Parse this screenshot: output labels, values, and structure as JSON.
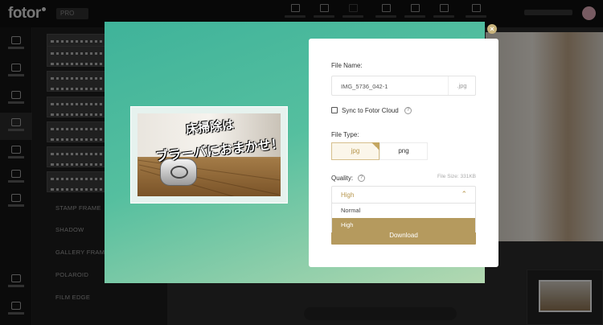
{
  "app": {
    "logo": "fotor",
    "menu_label": "PRO"
  },
  "user": {
    "name": ""
  },
  "sidebar": {
    "items": [
      {
        "name": "Basic"
      },
      {
        "name": "Effect"
      },
      {
        "name": "Beauty"
      },
      {
        "name": "Frames"
      },
      {
        "name": "Sticker"
      },
      {
        "name": "Text"
      },
      {
        "name": "Cloud"
      }
    ],
    "bottom": [
      "Settings",
      "Settings"
    ]
  },
  "frames_panel": {
    "categories": [
      "STAMP FRAME",
      "SHADOW",
      "GALLERY FRAME",
      "POLAROID",
      "FILM EDGE"
    ]
  },
  "preview": {
    "caption_line1": "床掃除は",
    "caption_line2": "ブラーバにおまかせ！"
  },
  "export_dialog": {
    "file_name_label": "File Name:",
    "file_name_value": "IMG_5736_042-1",
    "file_extension": ".jpg",
    "sync_label": "Sync to Fotor Cloud",
    "sync_checked": false,
    "file_type_label": "File Type:",
    "file_types": [
      "jpg",
      "png"
    ],
    "selected_file_type": "jpg",
    "quality_label": "Quality:",
    "file_size": "File Size: 331KB",
    "quality_value": "High",
    "quality_options": [
      "Normal",
      "High"
    ],
    "download_label": "Download",
    "help_symbol": "?",
    "close_symbol": "×",
    "chevron_symbol": "⌃"
  },
  "colors": {
    "accent_gold": "#b59a5e",
    "modal_teal": "#3fb39a",
    "app_dark": "#101010"
  }
}
